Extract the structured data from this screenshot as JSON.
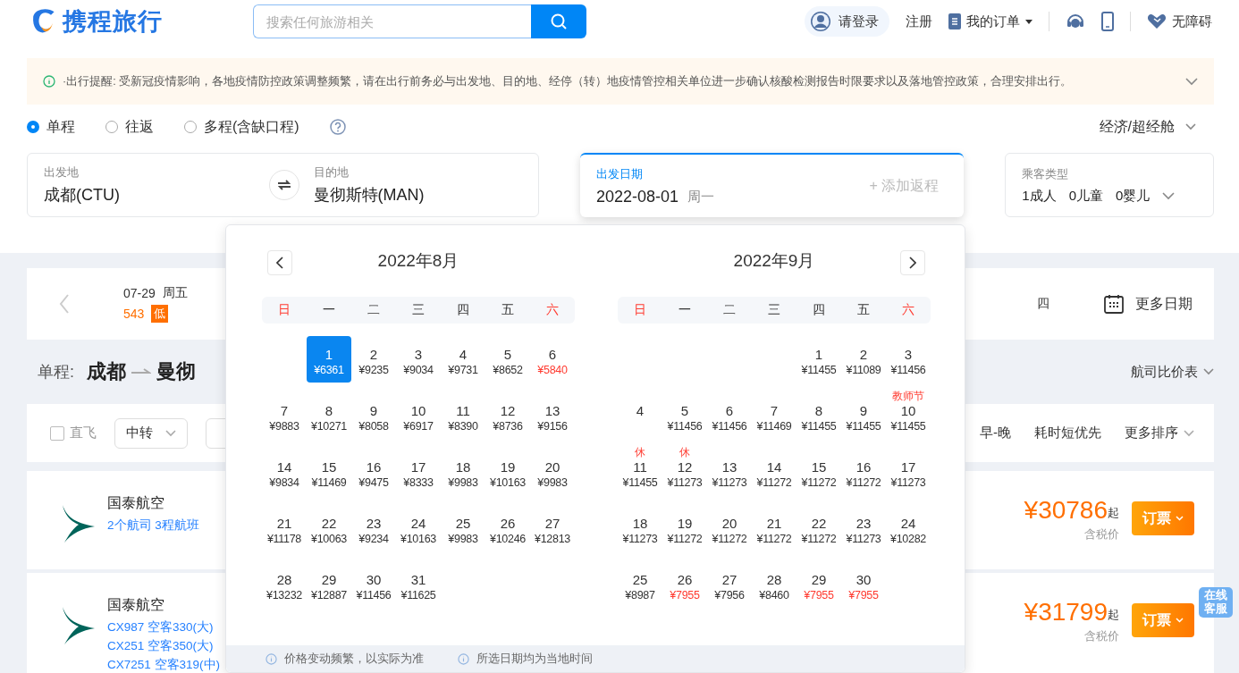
{
  "header": {
    "logo_text": "携程旅行",
    "search": {
      "placeholder": "搜索任何旅游相关"
    },
    "login": "请登录",
    "register": "注册",
    "orders": "我的订单",
    "accessibility": "无障碍"
  },
  "notice": {
    "text": "·出行提醒: 受新冠疫情影响，各地疫情防控政策调整频繁，请在出行前务必与出发地、目的地、经停（转）地疫情管控相关单位进一步确认核酸检测报告时限要求以及落地管控政策，合理安排出行。"
  },
  "trip_types": [
    {
      "label": "单程",
      "selected": true
    },
    {
      "label": "往返",
      "selected": false
    },
    {
      "label": "多程(含缺口程)",
      "selected": false
    }
  ],
  "cabin": "经济/超经舱",
  "origin": {
    "label": "出发地",
    "value": "成都(CTU)"
  },
  "destination": {
    "label": "目的地",
    "value": "曼彻斯特(MAN)"
  },
  "departure": {
    "label": "出发日期",
    "date": "2022-08-01",
    "weekday": "周一",
    "add_return": "+ 添加返程"
  },
  "passengers": {
    "label": "乘客类型",
    "adults": "1成人",
    "children": "0儿童",
    "infants": "0婴儿"
  },
  "date_strip": {
    "date": "07-29",
    "weekday": "周五",
    "price": "543",
    "tag": "低",
    "right_text": "四",
    "more": "更多日期"
  },
  "route": {
    "prefix": "单程:",
    "from": "成都",
    "to": "曼彻",
    "compare": "航司比价表"
  },
  "filters": {
    "direct": {
      "label": "直飞",
      "checked": false
    },
    "transfer": "中转",
    "sorts": [
      "早-晚",
      "耗时短优先"
    ],
    "more_sort": "更多排序"
  },
  "flights": [
    {
      "airline": "国泰航空",
      "details": [
        "2个航司  3程航班"
      ],
      "price": "¥30786",
      "price_suffix": "起",
      "tax_note": "含税价",
      "book": "订票"
    },
    {
      "airline": "国泰航空",
      "details": [
        "CX987 空客330(大)",
        "CX251 空客350(大)",
        "CX7251 空客319(中)"
      ],
      "price": "¥31799",
      "price_suffix": "起",
      "tax_note": "含税价",
      "book": "订票"
    }
  ],
  "online_service": "在线客服",
  "calendar": {
    "months": [
      {
        "title": "2022年8月",
        "weekdays": [
          "日",
          "一",
          "二",
          "三",
          "四",
          "五",
          "六"
        ],
        "weeks": [
          {
            "days": [
              {
                "kind": "blank"
              },
              {
                "day": "1",
                "price": "¥6361",
                "selected": true,
                "low": false
              },
              {
                "day": "2",
                "price": "¥9235",
                "selected": false,
                "low": false
              },
              {
                "day": "3",
                "price": "¥9034",
                "selected": false,
                "low": false
              },
              {
                "day": "4",
                "price": "¥9731",
                "selected": false,
                "low": false
              },
              {
                "day": "5",
                "price": "¥8652",
                "selected": false,
                "low": false
              },
              {
                "day": "6",
                "price": "¥5840",
                "selected": false,
                "low": true
              }
            ]
          },
          {
            "days": [
              {
                "day": "7",
                "price": "¥9883",
                "selected": false,
                "low": false
              },
              {
                "day": "8",
                "price": "¥10271",
                "selected": false,
                "low": false
              },
              {
                "day": "9",
                "price": "¥8058",
                "selected": false,
                "low": false
              },
              {
                "day": "10",
                "price": "¥6917",
                "selected": false,
                "low": false
              },
              {
                "day": "11",
                "price": "¥8390",
                "selected": false,
                "low": false
              },
              {
                "day": "12",
                "price": "¥8736",
                "selected": false,
                "low": false
              },
              {
                "day": "13",
                "price": "¥9156",
                "selected": false,
                "low": false
              }
            ]
          },
          {
            "days": [
              {
                "day": "14",
                "price": "¥9834",
                "selected": false,
                "low": false
              },
              {
                "day": "15",
                "price": "¥11469",
                "selected": false,
                "low": false
              },
              {
                "day": "16",
                "price": "¥9475",
                "selected": false,
                "low": false
              },
              {
                "day": "17",
                "price": "¥8333",
                "selected": false,
                "low": false
              },
              {
                "day": "18",
                "price": "¥9983",
                "selected": false,
                "low": false
              },
              {
                "day": "19",
                "price": "¥10163",
                "selected": false,
                "low": false
              },
              {
                "day": "20",
                "price": "¥9983",
                "selected": false,
                "low": false
              }
            ]
          },
          {
            "days": [
              {
                "day": "21",
                "price": "¥11178",
                "selected": false,
                "low": false
              },
              {
                "day": "22",
                "price": "¥10063",
                "selected": false,
                "low": false
              },
              {
                "day": "23",
                "price": "¥9234",
                "selected": false,
                "low": false
              },
              {
                "day": "24",
                "price": "¥10163",
                "selected": false,
                "low": false
              },
              {
                "day": "25",
                "price": "¥9983",
                "selected": false,
                "low": false
              },
              {
                "day": "26",
                "price": "¥10246",
                "selected": false,
                "low": false
              },
              {
                "day": "27",
                "price": "¥12813",
                "selected": false,
                "low": false
              }
            ]
          },
          {
            "days": [
              {
                "day": "28",
                "price": "¥13232",
                "selected": false,
                "low": false
              },
              {
                "day": "29",
                "price": "¥12887",
                "selected": false,
                "low": false
              },
              {
                "day": "30",
                "price": "¥11456",
                "selected": false,
                "low": false
              },
              {
                "day": "31",
                "price": "¥11625",
                "selected": false,
                "low": false
              }
            ]
          }
        ]
      },
      {
        "title": "2022年9月",
        "weekdays": [
          "日",
          "一",
          "二",
          "三",
          "四",
          "五",
          "六"
        ],
        "weeks": [
          {
            "days": [
              {
                "kind": "blank"
              },
              {
                "kind": "blank"
              },
              {
                "kind": "blank"
              },
              {
                "kind": "blank"
              },
              {
                "day": "1",
                "price": "¥11455",
                "selected": false,
                "low": false
              },
              {
                "day": "2",
                "price": "¥11089",
                "selected": false,
                "low": false
              },
              {
                "day": "3",
                "price": "¥11456",
                "selected": false,
                "low": false
              }
            ]
          },
          {
            "days": [
              {
                "kind": "day",
                "day": "4",
                "selected": false
              },
              {
                "day": "5",
                "price": "¥11456",
                "selected": false,
                "low": false
              },
              {
                "day": "6",
                "price": "¥11456",
                "selected": false,
                "low": false
              },
              {
                "day": "7",
                "price": "¥11469",
                "selected": false,
                "low": false
              },
              {
                "day": "8",
                "price": "¥11455",
                "selected": false,
                "low": false
              },
              {
                "day": "9",
                "price": "¥11455",
                "selected": false,
                "low": false
              },
              {
                "day": "10",
                "price": "¥11455",
                "note": "教师节",
                "selected": false,
                "low": false
              }
            ]
          },
          {
            "days": [
              {
                "day": "11",
                "price": "¥11455",
                "note": "休",
                "selected": false,
                "low": false
              },
              {
                "day": "12",
                "price": "¥11273",
                "note": "休",
                "selected": false,
                "low": false
              },
              {
                "day": "13",
                "price": "¥11273",
                "selected": false,
                "low": false
              },
              {
                "day": "14",
                "price": "¥11272",
                "selected": false,
                "low": false
              },
              {
                "day": "15",
                "price": "¥11272",
                "selected": false,
                "low": false
              },
              {
                "day": "16",
                "price": "¥11272",
                "selected": false,
                "low": false
              },
              {
                "day": "17",
                "price": "¥11273",
                "selected": false,
                "low": false
              }
            ]
          },
          {
            "days": [
              {
                "day": "18",
                "price": "¥11273",
                "selected": false,
                "low": false
              },
              {
                "day": "19",
                "price": "¥11272",
                "selected": false,
                "low": false
              },
              {
                "day": "20",
                "price": "¥11272",
                "selected": false,
                "low": false
              },
              {
                "day": "21",
                "price": "¥11272",
                "selected": false,
                "low": false
              },
              {
                "day": "22",
                "price": "¥11272",
                "selected": false,
                "low": false
              },
              {
                "day": "23",
                "price": "¥11273",
                "selected": false,
                "low": false
              },
              {
                "day": "24",
                "price": "¥10282",
                "selected": false,
                "low": false
              }
            ]
          },
          {
            "days": [
              {
                "day": "25",
                "price": "¥8987",
                "selected": false,
                "low": false
              },
              {
                "day": "26",
                "price": "¥7955",
                "selected": false,
                "low": true
              },
              {
                "day": "27",
                "price": "¥7956",
                "selected": false,
                "low": false
              },
              {
                "day": "28",
                "price": "¥8460",
                "selected": false,
                "low": false
              },
              {
                "day": "29",
                "price": "¥7955",
                "selected": false,
                "low": true
              },
              {
                "day": "30",
                "price": "¥7955",
                "selected": false,
                "low": true
              }
            ]
          }
        ]
      }
    ],
    "footer": [
      "价格变动频繁，以实际为准",
      "所选日期均为当地时间"
    ]
  }
}
